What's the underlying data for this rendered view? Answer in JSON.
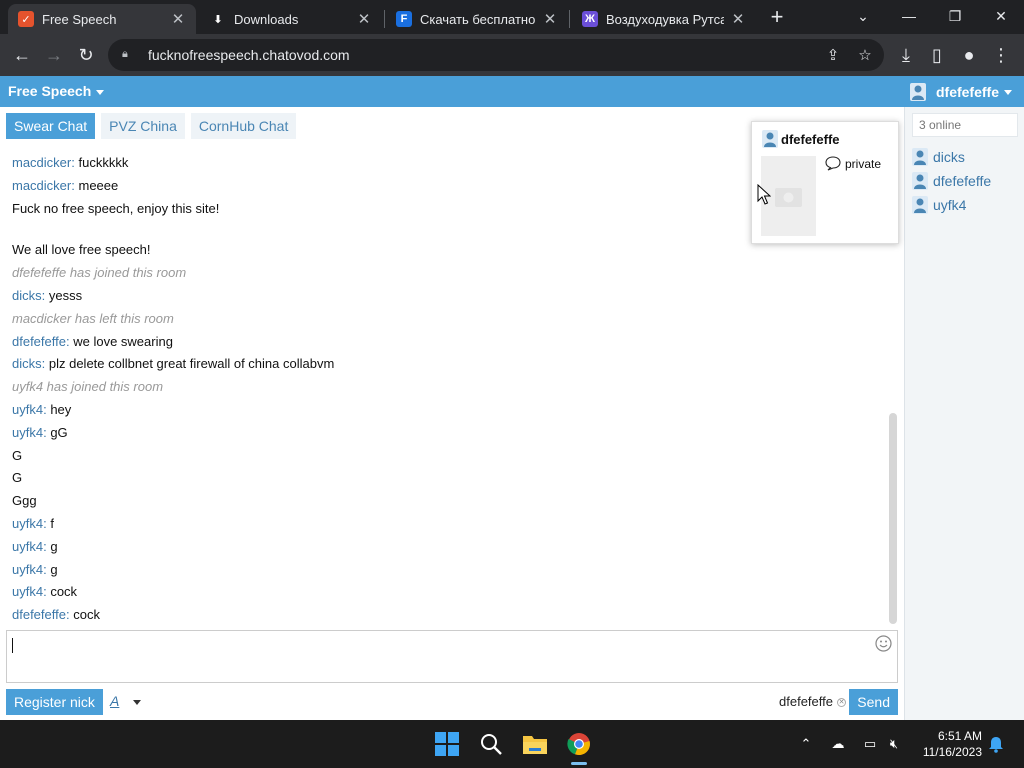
{
  "browser": {
    "tabs": [
      {
        "title": "Free Speech",
        "active": true
      },
      {
        "title": "Downloads",
        "active": false
      },
      {
        "title": "Скачать бесплатно Sh",
        "active": false
      },
      {
        "title": "Воздуходувка Рутса - …",
        "active": false
      }
    ],
    "url": "fucknofreespeech.chatovod.com"
  },
  "app": {
    "title": "Free Speech",
    "current_user": "dfefefeffe",
    "room_tabs": [
      "Swear Chat",
      "PVZ China",
      "CornHub Chat"
    ],
    "messages": [
      {
        "nick": "macdicker",
        "text": "fuckkkkk"
      },
      {
        "nick": "macdicker",
        "text": "meeee"
      },
      {
        "nick": "",
        "text": "Fuck no free speech, enjoy this site!"
      },
      {
        "nick": "",
        "text": ""
      },
      {
        "nick": "",
        "text": "We all love free speech!"
      },
      {
        "system": "dfefefeffe has joined this room"
      },
      {
        "nick": "dicks",
        "text": "yesss"
      },
      {
        "system": "macdicker has left this room"
      },
      {
        "nick": "dfefefeffe",
        "text": "we love swearing"
      },
      {
        "nick": "dicks",
        "text": "plz delete collbnet great firewall of china collabvm"
      },
      {
        "system": "uyfk4 has joined this room"
      },
      {
        "nick": "uyfk4",
        "text": "hey"
      },
      {
        "nick": "uyfk4",
        "text": "gG"
      },
      {
        "nick": "",
        "text": "G"
      },
      {
        "nick": "",
        "text": "G"
      },
      {
        "nick": "",
        "text": "Ggg"
      },
      {
        "nick": "uyfk4",
        "text": "f"
      },
      {
        "nick": "uyfk4",
        "text": "g"
      },
      {
        "nick": "uyfk4",
        "text": "g"
      },
      {
        "nick": "uyfk4",
        "text": "cock"
      },
      {
        "nick": "dfefefeffe",
        "text": "cock"
      }
    ],
    "online_count": "3 online",
    "online_users": [
      "dicks",
      "dfefefeffe",
      "uyfk4"
    ],
    "popup": {
      "nick": "dfefefeffe",
      "private_label": "private"
    },
    "register_label": "Register nick",
    "font_label": "A",
    "nick_chip": "dfefefeffe",
    "send_label": "Send"
  },
  "taskbar": {
    "time": "6:51 AM",
    "date": "11/16/2023"
  },
  "colors": {
    "accent": "#4a9fd8",
    "nick": "#3b77a8",
    "system": "#999999"
  }
}
